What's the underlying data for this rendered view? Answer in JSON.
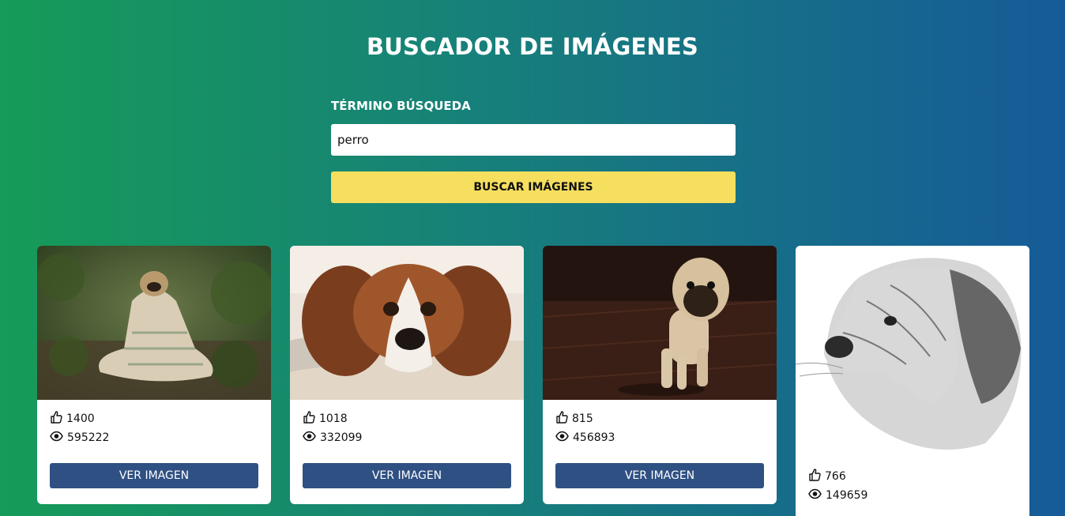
{
  "header": {
    "title": "BUSCADOR DE IMÁGENES"
  },
  "search": {
    "label": "TÉRMINO BÚSQUEDA",
    "value": "perro",
    "button_label": "BUSCAR IMÁGENES"
  },
  "results": [
    {
      "likes": "1400",
      "views": "595222",
      "button_label": "VER IMAGEN",
      "subject": "pug wrapped in blanket in forest"
    },
    {
      "likes": "1018",
      "views": "332099",
      "button_label": "VER IMAGEN",
      "subject": "cavalier spaniel lying on rug"
    },
    {
      "likes": "815",
      "views": "456893",
      "button_label": "VER IMAGEN",
      "subject": "pug puppy standing on wood floor"
    },
    {
      "likes": "766",
      "views": "149659",
      "subject": "sketch of dog head"
    }
  ],
  "icons": {
    "likes": "thumbs-up-icon",
    "views": "eye-icon"
  },
  "colors": {
    "gradient_start": "#169b58",
    "gradient_end": "#165b98",
    "search_button": "#f6df5e",
    "view_button": "#2f5083"
  }
}
